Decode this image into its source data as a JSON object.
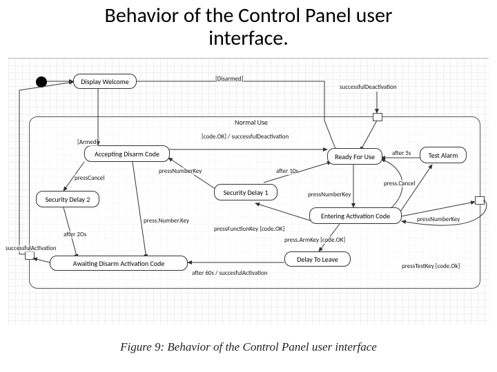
{
  "title_line1": "Behavior of the Control Panel user",
  "title_line2": "interface.",
  "caption": "Figure 9: Behavior of the Control Panel user interface",
  "frame_label": "Normal Use",
  "states": {
    "display_welcome": "Display Welcome",
    "accepting_disarm": "Accepting Disarm Code",
    "security_delay_2": "Security Delay 2",
    "awaiting_disarm": "Awaiting Disarm Activation Code",
    "security_delay_1": "Security Delay 1",
    "ready_for_use": "Ready For Use",
    "entering_activation": "Entering Activation Code",
    "delay_to_leave": "Delay To Leave",
    "test_alarm": "Test Alarm"
  },
  "edges": {
    "disarmed": "[Disarmed]",
    "successful_deactivation_top": "successfulDeactivation",
    "armed": "[Armed]",
    "press_cancel_left": "pressCancel",
    "after_20s": "after 2Os",
    "successful_activation": "successfulActivation",
    "press_number_key_1": "pressNumberKey",
    "press_number_key_2": "press.Number.Key",
    "codeok_deact": "[code.OK] / successfulDeactivation",
    "after_10s": "after 10s",
    "press_function_key": "pressFunctionKey [code.OK]",
    "press_arm_key": "press.ArmKey [code.OK]",
    "after_60s": "after 60s / succesfulActivation",
    "press_number_key_3": "pressNumberKey",
    "press_cancel_right": "press.Cancel",
    "after_5s": "after 5s",
    "press_number_key_4": "pressNumberKey",
    "press_test_key": "pressTestKey [code.Ok]"
  }
}
